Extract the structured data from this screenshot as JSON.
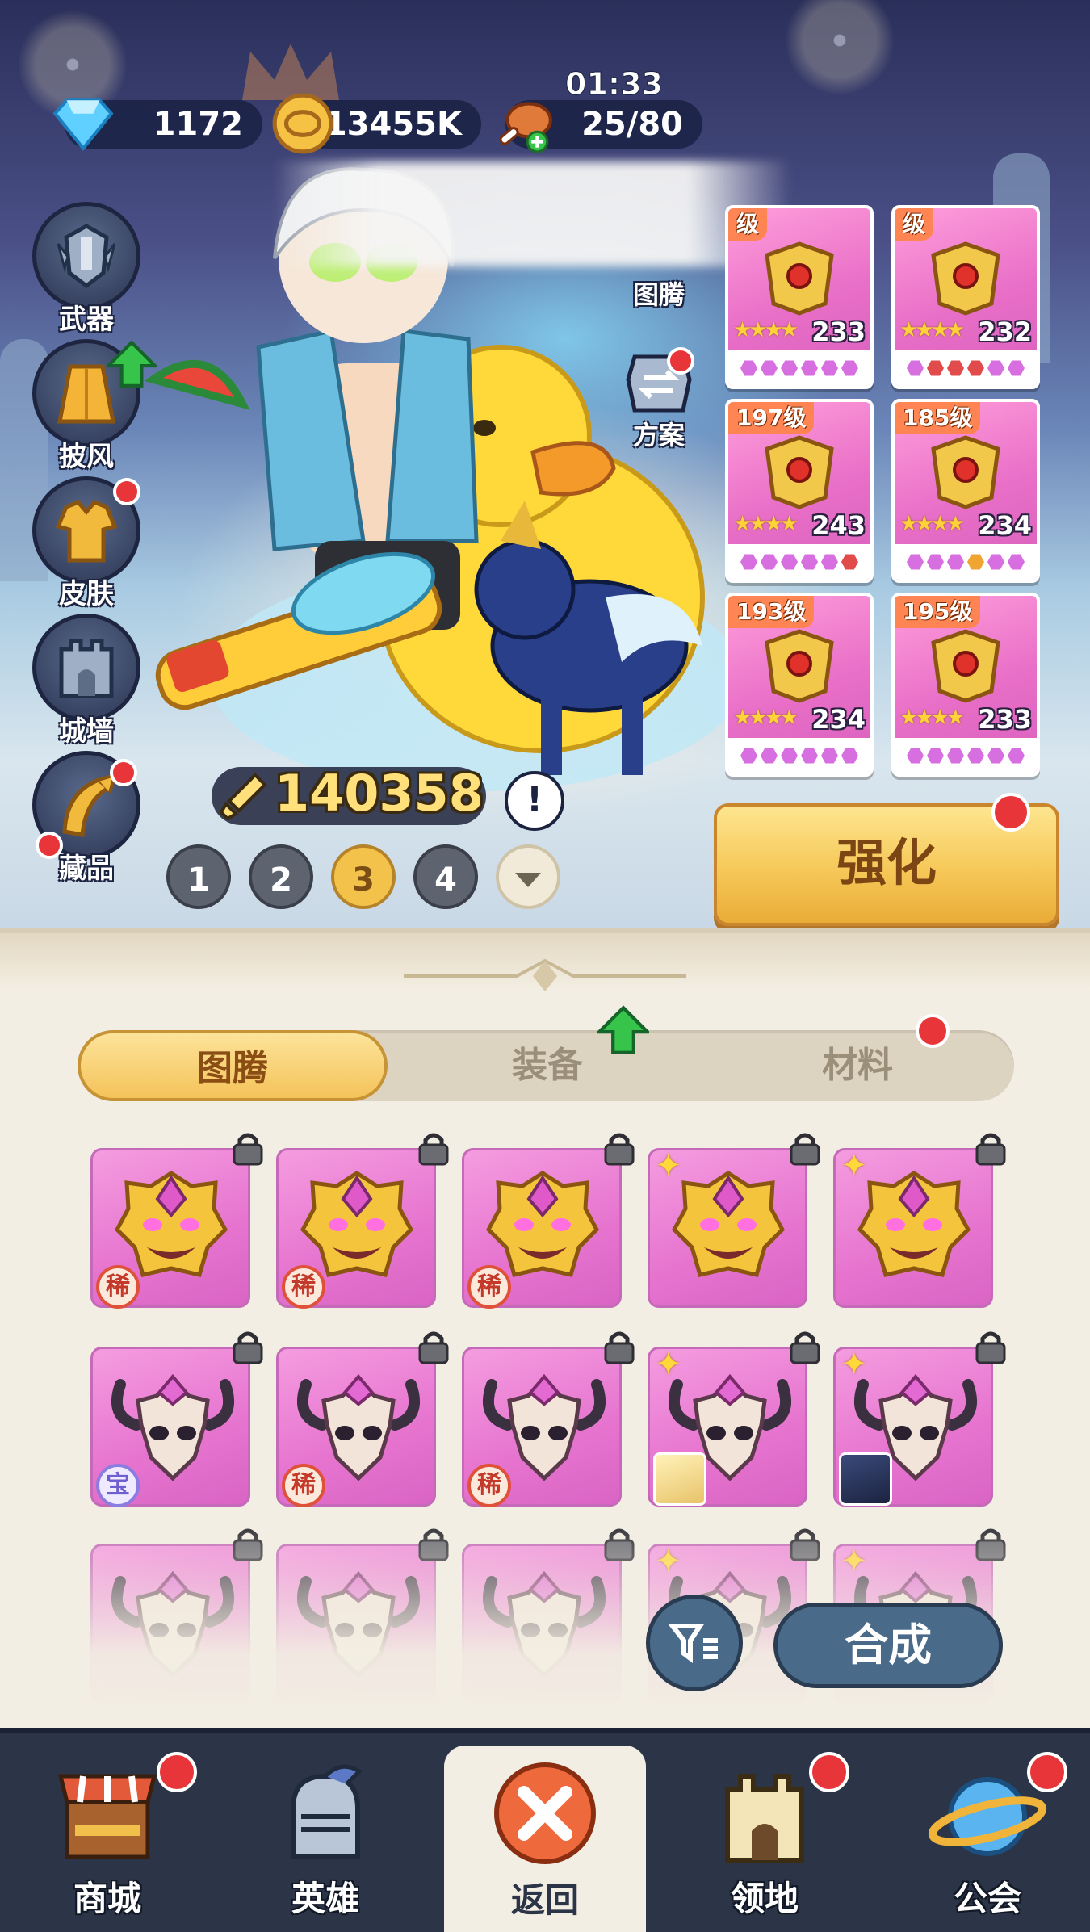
{
  "resources": {
    "diamonds": "1172",
    "gold": "13455K",
    "stamina": "25/80",
    "stamina_timer": "01:33"
  },
  "side_menu": [
    {
      "label": "武器",
      "icon": "weapon-emblem-icon",
      "dot": false
    },
    {
      "label": "披风",
      "icon": "cape-icon",
      "dot": false,
      "upgrade": true
    },
    {
      "label": "皮肤",
      "icon": "skin-outfit-icon",
      "dot": true
    },
    {
      "label": "城墙",
      "icon": "castle-wall-icon",
      "dot": false
    },
    {
      "label": "藏品",
      "icon": "collection-horn-icon",
      "dot": true
    }
  ],
  "right_menu": [
    {
      "label": "图腾",
      "icon": "totem-icon"
    },
    {
      "label": "方案",
      "icon": "plan-swap-icon"
    }
  ],
  "equipment": [
    {
      "level": "级",
      "stars": "★★★★",
      "value": "233",
      "gems": [
        "p",
        "p",
        "p",
        "p",
        "p",
        "p"
      ]
    },
    {
      "level": "级",
      "stars": "★★★★",
      "value": "232",
      "gems": [
        "p",
        "r",
        "r",
        "r",
        "p",
        "p"
      ]
    },
    {
      "level": "197级",
      "stars": "★★★★",
      "value": "243",
      "gems": [
        "p",
        "p",
        "p",
        "p",
        "p",
        "r"
      ]
    },
    {
      "level": "185级",
      "stars": "★★★★",
      "value": "234",
      "gems": [
        "p",
        "p",
        "p",
        "o",
        "p",
        "p"
      ]
    },
    {
      "level": "193级",
      "stars": "★★★★",
      "value": "234",
      "gems": [
        "p",
        "p",
        "p",
        "p",
        "p",
        "p"
      ]
    },
    {
      "level": "195级",
      "stars": "★★★★",
      "value": "233",
      "gems": [
        "p",
        "p",
        "p",
        "p",
        "p",
        "p"
      ]
    }
  ],
  "power": "140358",
  "info_label": "!",
  "pages": [
    "1",
    "2",
    "3",
    "4"
  ],
  "active_page": "3",
  "strengthen_label": "强化",
  "tabs": [
    {
      "label": "图腾",
      "active": true
    },
    {
      "label": "装备",
      "active": false,
      "upgrade": true
    },
    {
      "label": "材料",
      "active": false,
      "dot": true
    }
  ],
  "totems_row1": [
    {
      "kind": "lion",
      "tag": "稀"
    },
    {
      "kind": "lion",
      "tag": "稀"
    },
    {
      "kind": "lion",
      "tag": "稀"
    },
    {
      "kind": "lion",
      "tag": ""
    },
    {
      "kind": "lion",
      "tag": ""
    }
  ],
  "totems_row2": [
    {
      "kind": "skull",
      "tag": "宝"
    },
    {
      "kind": "skull",
      "tag": "稀"
    },
    {
      "kind": "skull",
      "tag": "稀"
    },
    {
      "kind": "skull",
      "tag": ""
    },
    {
      "kind": "skull",
      "tag": ""
    }
  ],
  "synthesize_label": "合成",
  "nav": [
    {
      "label": "商城",
      "icon": "shop-stall-icon",
      "dot": true
    },
    {
      "label": "英雄",
      "icon": "knight-helmet-icon",
      "dot": false
    },
    {
      "label": "返回",
      "icon": "close-x-icon",
      "dot": false,
      "active": true
    },
    {
      "label": "领地",
      "icon": "territory-tower-icon",
      "dot": true
    },
    {
      "label": "公会",
      "icon": "guild-planet-icon",
      "dot": true
    }
  ],
  "colors": {
    "accent_gold": "#f4c35a",
    "card_pink": "#e674cf",
    "nav_bg": "#2c3547",
    "badge_red": "#e8353a"
  }
}
